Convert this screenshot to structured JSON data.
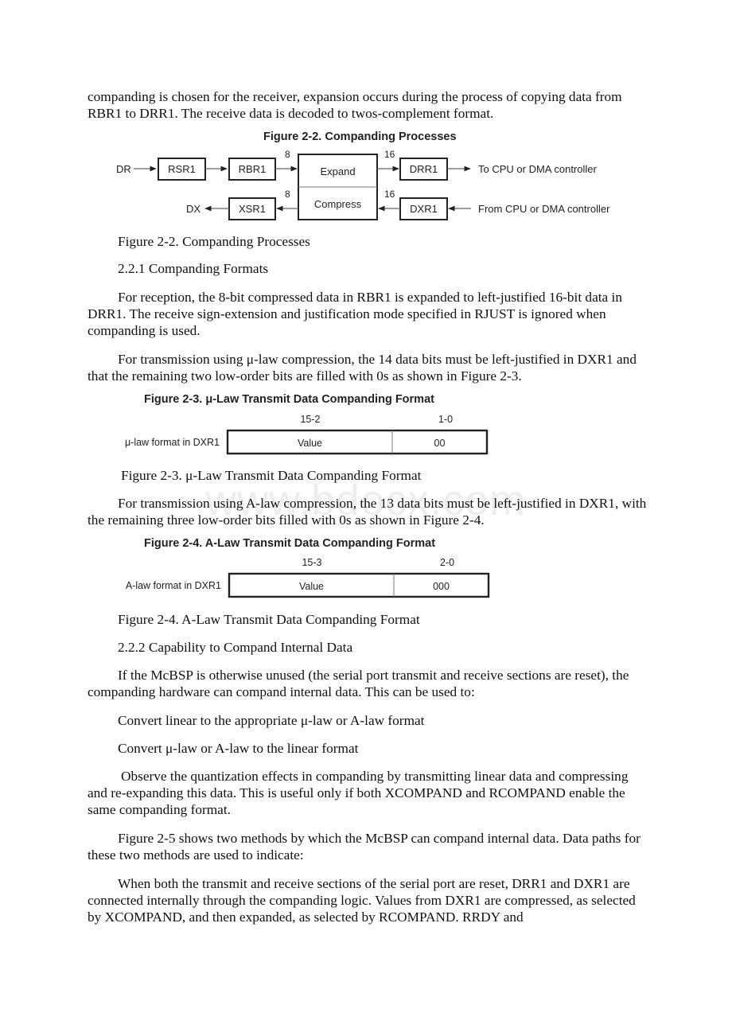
{
  "paragraphs": {
    "p1": "companding is chosen for the receiver, expansion occurs during the process of copying data from RBR1 to DRR1. The receive data is decoded to twos-complement format.",
    "fig22_caption": "Figure 2-2. Companding Processes",
    "sec221": "2.2.1 Companding Formats",
    "p2": "For reception, the 8-bit compressed data in RBR1 is expanded to left-justified 16-bit data in DRR1. The receive sign-extension and justification mode specified in RJUST is ignored when companding is used.",
    "p3": "For transmission using μ-law compression, the 14 data bits must be left-justified in DXR1 and that the remaining two low-order bits are filled with 0s as shown in Figure 2-3.",
    "fig23_caption": "Figure 2-3. μ-Law Transmit Data Companding Format",
    "p4": "For transmission using A-law compression, the 13 data bits must be left-justified in DXR1, with the remaining three low-order bits filled with 0s as shown in Figure 2-4.",
    "fig24_caption": "Figure 2-4. A-Law Transmit Data Companding Format",
    "sec222": "2.2.2 Capability to Compand Internal Data",
    "p5": "If the McBSP is otherwise unused (the serial port transmit and receive sections are reset), the companding hardware can compand internal data. This can be used to:",
    "bullet1": "Convert linear to the appropriate μ-law or A-law format",
    "bullet2": "Convert μ-law or A-law to the linear format",
    "p6": "Observe the quantization effects in companding by transmitting linear data and compressing and re-expanding this data. This is useful only if both XCOMPAND and RCOMPAND enable the same companding format.",
    "p7": "Figure 2-5 shows two methods by which the McBSP can compand internal data. Data paths for these two methods are used to indicate:",
    "p8": "When both the transmit and receive sections of the serial port are reset, DRR1 and DXR1 are connected internally through the companding logic. Values from DXR1 are compressed, as selected by XCOMPAND, and then expanded, as selected by RCOMPAND. RRDY and"
  },
  "watermark": "www.bdocx.com",
  "figure22": {
    "title": "Figure 2-2. Companding Processes",
    "dr": "DR",
    "dx": "DX",
    "rsr1": "RSR1",
    "rbr1": "RBR1",
    "xsr1": "XSR1",
    "expand": "Expand",
    "compress": "Compress",
    "drr1": "DRR1",
    "dxr1": "DXR1",
    "bits8_top": "8",
    "bits8_bottom": "8",
    "bits16_top": "16",
    "bits16_bottom": "16",
    "to_cpu": "To CPU or DMA controller",
    "from_cpu": "From CPU or DMA controller"
  },
  "figure23": {
    "title": "Figure 2-3.  μ-Law Transmit Data Companding Format",
    "row_label": "μ-law format in DXR1",
    "field1_bits": "15-2",
    "field2_bits": "1-0",
    "field1_value": "Value",
    "field2_value": "00"
  },
  "figure24": {
    "title": "Figure 2-4.  A-Law Transmit Data Companding Format",
    "row_label": "A-law format in DXR1",
    "field1_bits": "15-3",
    "field2_bits": "2-0",
    "field1_value": "Value",
    "field2_value": "000"
  }
}
